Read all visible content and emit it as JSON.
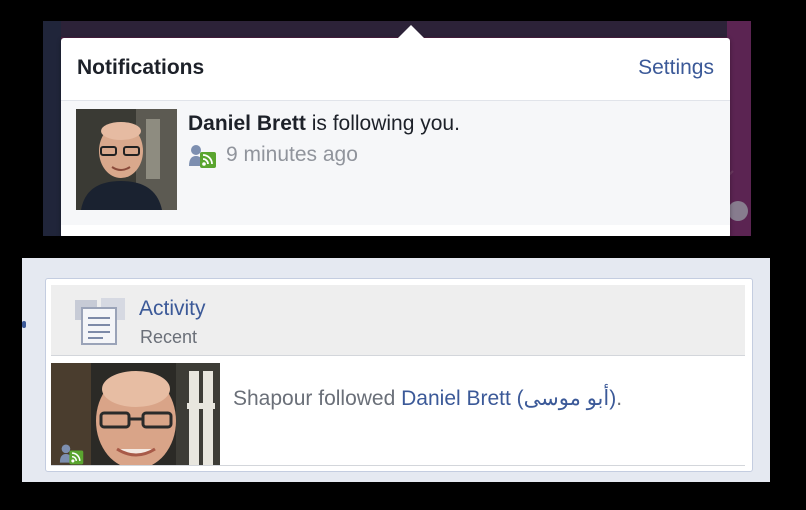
{
  "notifications": {
    "title": "Notifications",
    "settings_label": "Settings",
    "item": {
      "name": "Daniel Brett",
      "action": " is following you.",
      "time": "9 minutes ago",
      "icon": "follow-rss-icon"
    }
  },
  "activity": {
    "title": "Activity",
    "subtitle": "Recent",
    "story": {
      "prefix": "Shapour followed ",
      "link": "Daniel Brett (أبو موسى)",
      "suffix": ".",
      "icon": "follow-rss-icon"
    }
  },
  "colors": {
    "link_blue": "#3b5998",
    "meta_gray": "#90949c",
    "follow_green": "#5aa52f"
  }
}
